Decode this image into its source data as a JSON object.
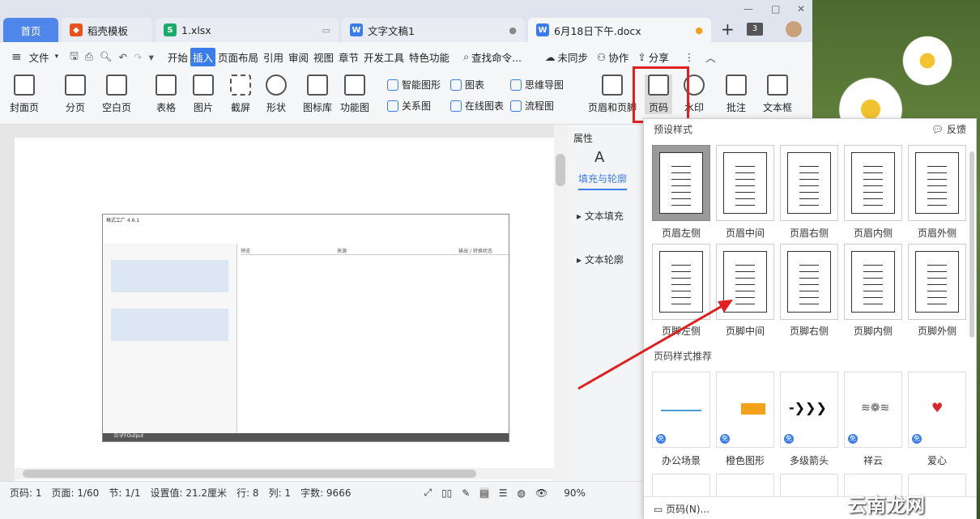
{
  "tabs": {
    "home": "首页",
    "t1": "稻壳模板",
    "t2": "1.xlsx",
    "t3": "文字文稿1",
    "t4": "6月18日下午.docx",
    "count": "3"
  },
  "menu": {
    "file": "文件",
    "items": [
      "开始",
      "插入",
      "页面布局",
      "引用",
      "审阅",
      "视图",
      "章节",
      "开发工具",
      "特色功能"
    ],
    "search": "查找命令...",
    "sync": "未同步",
    "collab": "协作",
    "share": "分享"
  },
  "ribbon": {
    "cover": "封面页",
    "section": "分页",
    "blank": "空白页",
    "table": "表格",
    "picture": "图片",
    "screenshot": "截屏",
    "shape": "形状",
    "iconlib": "图标库",
    "funcchart": "功能图",
    "smart": "智能图形",
    "chart": "图表",
    "mindmap": "思维导图",
    "relation": "关系图",
    "onlinechart": "在线图表",
    "flow": "流程图",
    "headerfooter": "页眉和页脚",
    "pagenum": "页码",
    "watermark": "水印",
    "comment": "批注",
    "textbox": "文本框"
  },
  "props": {
    "title": "属性",
    "fill_outline": "填充与轮廓",
    "text_fill": "文本填充",
    "text_outline": "文本轮廓"
  },
  "status": {
    "page": "页码: 1",
    "pages": "页面: 1/60",
    "section": "节: 1/1",
    "setting": "设置值: 21.2厘米",
    "row": "行: 8",
    "col": "列: 1",
    "words": "字数: 9666",
    "zoom": "90%"
  },
  "dropdown": {
    "preset": "预设样式",
    "feedback": "反馈",
    "items": [
      "页眉左侧",
      "页眉中间",
      "页眉右侧",
      "页眉内侧",
      "页眉外侧",
      "页脚左侧",
      "页脚中间",
      "页脚右侧",
      "页脚内侧",
      "页脚外侧"
    ],
    "recommend": "页码样式推荐",
    "cards": [
      "办公场景",
      "橙色图形",
      "多级箭头",
      "祥云",
      "爱心"
    ],
    "free": "免",
    "more": "页码(N)..."
  },
  "embedded": {
    "title": "格式工厂 4.6.1",
    "output": "D:\\FFOutput",
    "cols": [
      "预览",
      "来源",
      "输出 / 转换状态"
    ]
  },
  "watermark_text": "云南龙网"
}
